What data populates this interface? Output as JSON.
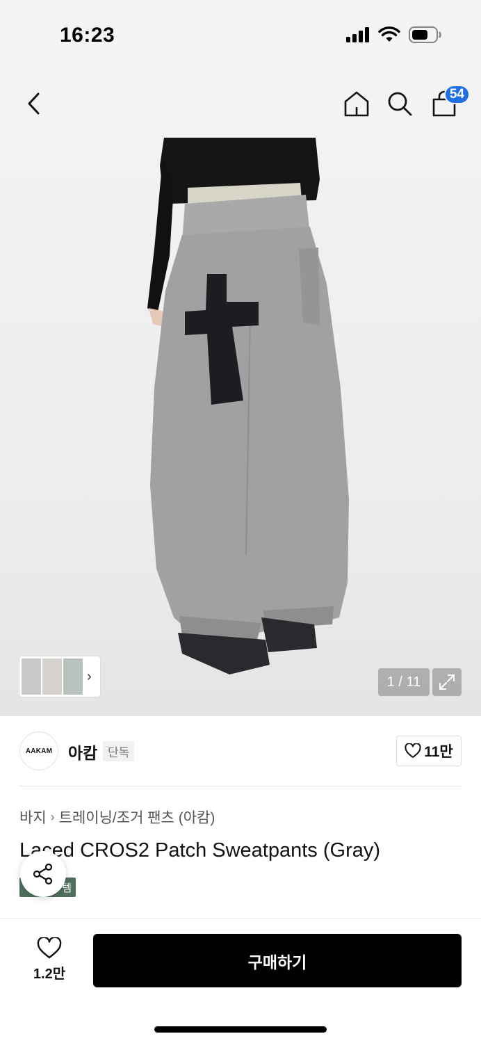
{
  "status": {
    "time": "16:23"
  },
  "nav": {
    "cart_count": "54"
  },
  "gallery": {
    "counter": "1 / 11"
  },
  "brand": {
    "logo_text": "AAKAM",
    "name": "아캄",
    "tag": "단독",
    "likes": "11만"
  },
  "breadcrumb": {
    "category": "바지",
    "subcategory": "트레이닝/조거 팬츠 (아캄)"
  },
  "product": {
    "title": "Laced CROS2 Patch Sweatpants (Gray)",
    "badge_text": "템"
  },
  "bottom": {
    "wish_count": "1.2만",
    "buy_label": "구매하기"
  },
  "colors": {
    "accent_badge": "#1f6fe5",
    "buy_button": "#000000",
    "green_badge": "#4f6f5b"
  }
}
